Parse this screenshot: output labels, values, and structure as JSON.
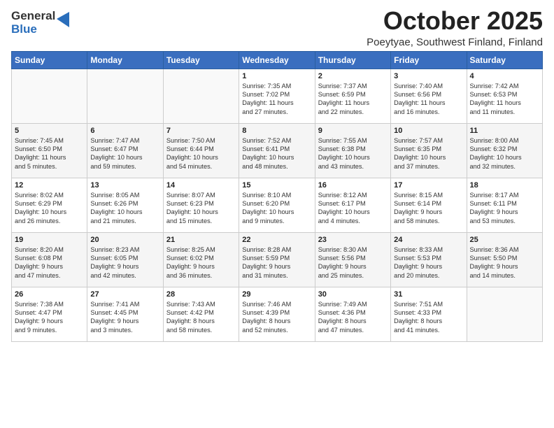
{
  "logo": {
    "general": "General",
    "blue": "Blue"
  },
  "header": {
    "month": "October 2025",
    "location": "Poeytyae, Southwest Finland, Finland"
  },
  "weekdays": [
    "Sunday",
    "Monday",
    "Tuesday",
    "Wednesday",
    "Thursday",
    "Friday",
    "Saturday"
  ],
  "weeks": [
    [
      {
        "day": "",
        "info": ""
      },
      {
        "day": "",
        "info": ""
      },
      {
        "day": "",
        "info": ""
      },
      {
        "day": "1",
        "info": "Sunrise: 7:35 AM\nSunset: 7:02 PM\nDaylight: 11 hours\nand 27 minutes."
      },
      {
        "day": "2",
        "info": "Sunrise: 7:37 AM\nSunset: 6:59 PM\nDaylight: 11 hours\nand 22 minutes."
      },
      {
        "day": "3",
        "info": "Sunrise: 7:40 AM\nSunset: 6:56 PM\nDaylight: 11 hours\nand 16 minutes."
      },
      {
        "day": "4",
        "info": "Sunrise: 7:42 AM\nSunset: 6:53 PM\nDaylight: 11 hours\nand 11 minutes."
      }
    ],
    [
      {
        "day": "5",
        "info": "Sunrise: 7:45 AM\nSunset: 6:50 PM\nDaylight: 11 hours\nand 5 minutes."
      },
      {
        "day": "6",
        "info": "Sunrise: 7:47 AM\nSunset: 6:47 PM\nDaylight: 10 hours\nand 59 minutes."
      },
      {
        "day": "7",
        "info": "Sunrise: 7:50 AM\nSunset: 6:44 PM\nDaylight: 10 hours\nand 54 minutes."
      },
      {
        "day": "8",
        "info": "Sunrise: 7:52 AM\nSunset: 6:41 PM\nDaylight: 10 hours\nand 48 minutes."
      },
      {
        "day": "9",
        "info": "Sunrise: 7:55 AM\nSunset: 6:38 PM\nDaylight: 10 hours\nand 43 minutes."
      },
      {
        "day": "10",
        "info": "Sunrise: 7:57 AM\nSunset: 6:35 PM\nDaylight: 10 hours\nand 37 minutes."
      },
      {
        "day": "11",
        "info": "Sunrise: 8:00 AM\nSunset: 6:32 PM\nDaylight: 10 hours\nand 32 minutes."
      }
    ],
    [
      {
        "day": "12",
        "info": "Sunrise: 8:02 AM\nSunset: 6:29 PM\nDaylight: 10 hours\nand 26 minutes."
      },
      {
        "day": "13",
        "info": "Sunrise: 8:05 AM\nSunset: 6:26 PM\nDaylight: 10 hours\nand 21 minutes."
      },
      {
        "day": "14",
        "info": "Sunrise: 8:07 AM\nSunset: 6:23 PM\nDaylight: 10 hours\nand 15 minutes."
      },
      {
        "day": "15",
        "info": "Sunrise: 8:10 AM\nSunset: 6:20 PM\nDaylight: 10 hours\nand 9 minutes."
      },
      {
        "day": "16",
        "info": "Sunrise: 8:12 AM\nSunset: 6:17 PM\nDaylight: 10 hours\nand 4 minutes."
      },
      {
        "day": "17",
        "info": "Sunrise: 8:15 AM\nSunset: 6:14 PM\nDaylight: 9 hours\nand 58 minutes."
      },
      {
        "day": "18",
        "info": "Sunrise: 8:17 AM\nSunset: 6:11 PM\nDaylight: 9 hours\nand 53 minutes."
      }
    ],
    [
      {
        "day": "19",
        "info": "Sunrise: 8:20 AM\nSunset: 6:08 PM\nDaylight: 9 hours\nand 47 minutes."
      },
      {
        "day": "20",
        "info": "Sunrise: 8:23 AM\nSunset: 6:05 PM\nDaylight: 9 hours\nand 42 minutes."
      },
      {
        "day": "21",
        "info": "Sunrise: 8:25 AM\nSunset: 6:02 PM\nDaylight: 9 hours\nand 36 minutes."
      },
      {
        "day": "22",
        "info": "Sunrise: 8:28 AM\nSunset: 5:59 PM\nDaylight: 9 hours\nand 31 minutes."
      },
      {
        "day": "23",
        "info": "Sunrise: 8:30 AM\nSunset: 5:56 PM\nDaylight: 9 hours\nand 25 minutes."
      },
      {
        "day": "24",
        "info": "Sunrise: 8:33 AM\nSunset: 5:53 PM\nDaylight: 9 hours\nand 20 minutes."
      },
      {
        "day": "25",
        "info": "Sunrise: 8:36 AM\nSunset: 5:50 PM\nDaylight: 9 hours\nand 14 minutes."
      }
    ],
    [
      {
        "day": "26",
        "info": "Sunrise: 7:38 AM\nSunset: 4:47 PM\nDaylight: 9 hours\nand 9 minutes."
      },
      {
        "day": "27",
        "info": "Sunrise: 7:41 AM\nSunset: 4:45 PM\nDaylight: 9 hours\nand 3 minutes."
      },
      {
        "day": "28",
        "info": "Sunrise: 7:43 AM\nSunset: 4:42 PM\nDaylight: 8 hours\nand 58 minutes."
      },
      {
        "day": "29",
        "info": "Sunrise: 7:46 AM\nSunset: 4:39 PM\nDaylight: 8 hours\nand 52 minutes."
      },
      {
        "day": "30",
        "info": "Sunrise: 7:49 AM\nSunset: 4:36 PM\nDaylight: 8 hours\nand 47 minutes."
      },
      {
        "day": "31",
        "info": "Sunrise: 7:51 AM\nSunset: 4:33 PM\nDaylight: 8 hours\nand 41 minutes."
      },
      {
        "day": "",
        "info": ""
      }
    ]
  ]
}
